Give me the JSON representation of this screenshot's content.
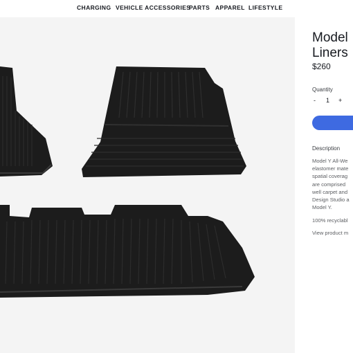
{
  "nav": {
    "items": [
      "CHARGING",
      "VEHICLE ACCESSORIES",
      "PARTS",
      "APPAREL",
      "LIFESTYLE"
    ]
  },
  "product": {
    "title_line1": "Model",
    "title_line2": "Liners",
    "price": "$260",
    "quantity_label": "Quantity",
    "quantity_minus": "-",
    "quantity_value": "1",
    "quantity_plus": "+",
    "description_label": "Description",
    "description_lines": [
      "Model Y All-We",
      "elastomer mate",
      "spatial coverag",
      "are comprised",
      "well carpet and",
      "Design Studio a",
      "Model Y."
    ],
    "recyclable_text": "100% recyclabl",
    "view_link": "View product m"
  },
  "colors": {
    "accent": "#3e6ae1",
    "gallery_bg": "#f4f4f4",
    "mat": "#1c1c1c"
  }
}
